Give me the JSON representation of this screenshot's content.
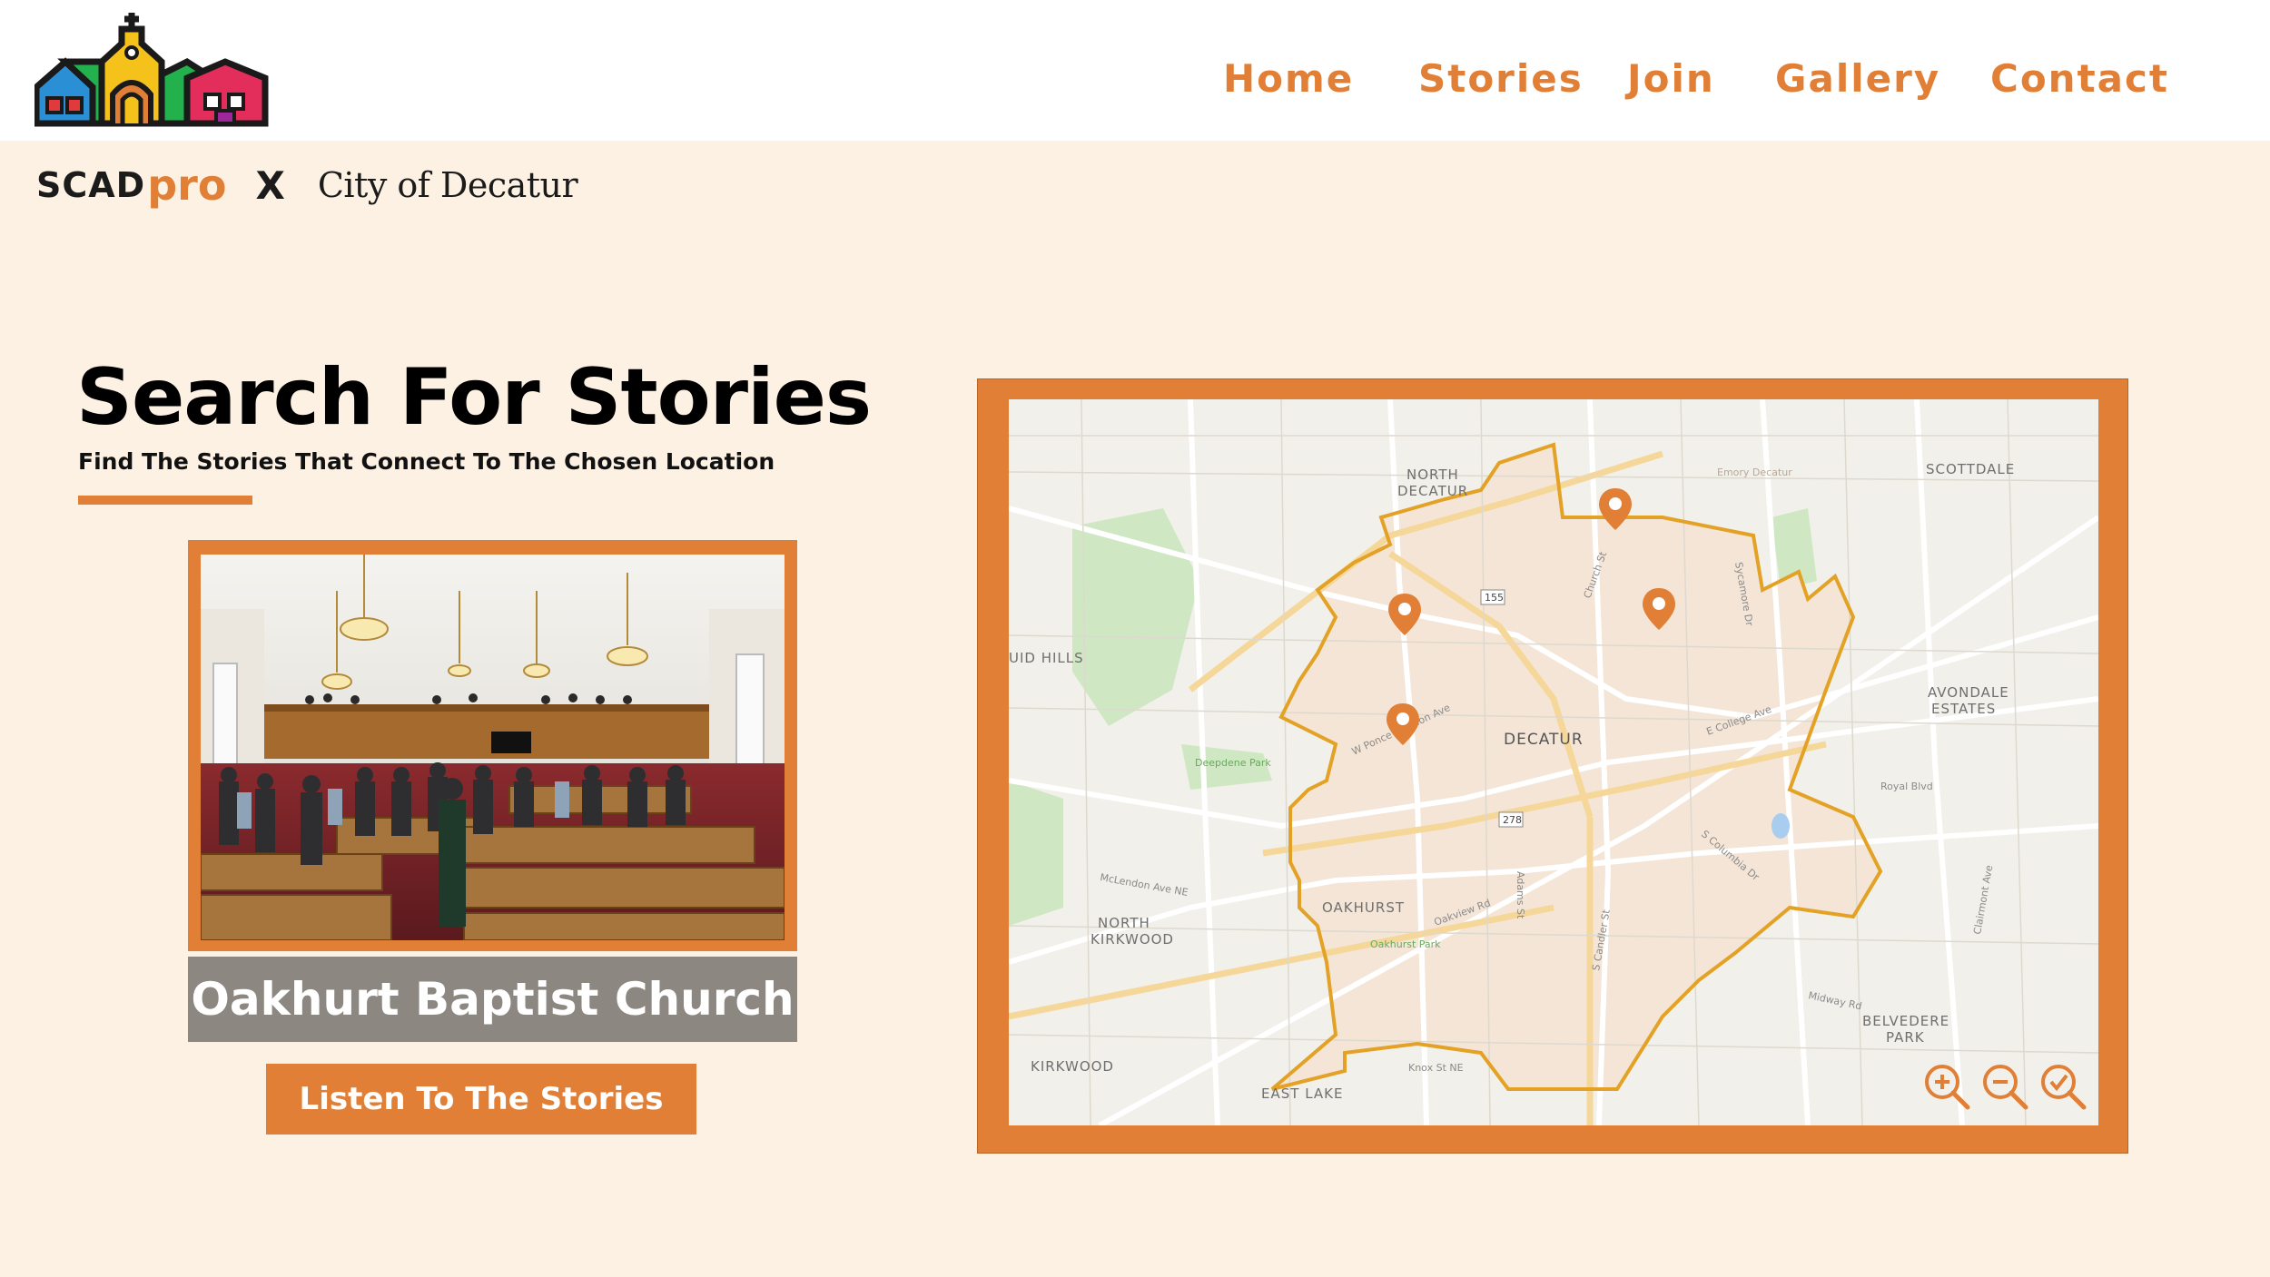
{
  "header": {
    "logo_icon": "houses-logo-icon",
    "nav": [
      {
        "label": "Home",
        "id": "home"
      },
      {
        "label": "Stories",
        "id": "stories"
      },
      {
        "label": "Join",
        "id": "join"
      },
      {
        "label": "Gallery",
        "id": "gallery"
      },
      {
        "label": "Contact",
        "id": "contact"
      }
    ]
  },
  "partner": {
    "scad": "SCAD",
    "pro": "pro",
    "x": "X",
    "city": "City of Decatur"
  },
  "main": {
    "title": "Search For Stories",
    "subtitle": "Find The Stories That Connect To The Chosen Location",
    "photo_icon": "church-interior-photo",
    "caption": "Oakhurt Baptist Church",
    "button": "Listen To The Stories"
  },
  "map": {
    "labels": {
      "north_decatur_1": "NORTH",
      "north_decatur_2": "DECATUR",
      "scottdale": "SCOTTDALE",
      "druid_hills": "UID HILLS",
      "decatur": "DECATUR",
      "avondale_1": "AVONDALE",
      "avondale_2": "ESTATES",
      "oakhurst": "OAKHURST",
      "north_kirkwood_1": "NORTH",
      "north_kirkwood_2": "KIRKWOOD",
      "belvedere_1": "BELVEDERE",
      "belvedere_2": "PARK",
      "kirkwood": "KIRKWOOD",
      "east_lake": "EAST LAKE",
      "emory": "Emory Decatur",
      "oakhurst_park": "Oakhurst Park",
      "deepdene": "Deepdene Park",
      "church_st": "Church St",
      "e_college": "E College Ave",
      "w_ponce": "W Ponce de Leon Ave",
      "s_columbia": "S Columbia Dr",
      "oakview": "Oakview Rd",
      "mclendon": "McLendon Ave NE",
      "adams": "Adams St",
      "s_candler": "S Candler St",
      "knox": "Knox St NE",
      "royal": "Royal Blvd",
      "midway": "Midway Rd",
      "sycamore": "Sycamore Dr",
      "clairmont": "Clairmont Ave",
      "route_155": "155",
      "route_278": "278"
    },
    "pin_color": "#e07f35",
    "boundary_color": "#e3a225",
    "controls": [
      {
        "icon": "zoom-in-icon"
      },
      {
        "icon": "zoom-out-icon"
      },
      {
        "icon": "zoom-confirm-icon"
      }
    ]
  }
}
